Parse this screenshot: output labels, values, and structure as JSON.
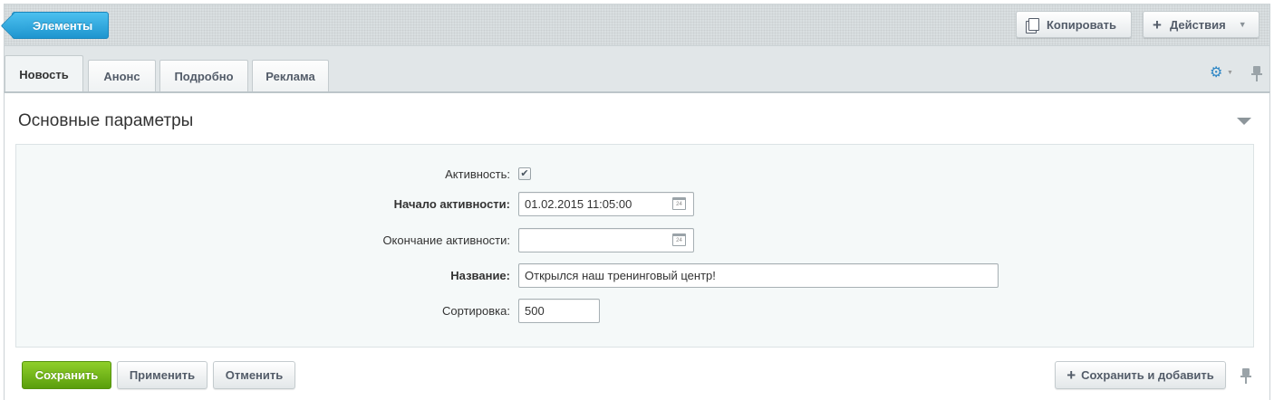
{
  "toolbar": {
    "back_label": "Элементы",
    "copy_label": "Копировать",
    "actions_label": "Действия",
    "icons": {
      "copy": "copy-icon",
      "plus": "plus-icon",
      "caret": "chevron-down-icon"
    }
  },
  "tabs": [
    {
      "label": "Новость",
      "active": true
    },
    {
      "label": "Анонс",
      "active": false
    },
    {
      "label": "Подробно",
      "active": false
    },
    {
      "label": "Реклама",
      "active": false
    }
  ],
  "section": {
    "title": "Основные параметры"
  },
  "form": {
    "active_label": "Активность:",
    "active_checked": true,
    "start_label": "Начало активности:",
    "start_value": "01.02.2015 11:05:00",
    "end_label": "Окончание активности:",
    "end_value": "",
    "name_label": "Название:",
    "name_value": "Открылся наш тренинговый центр!",
    "sort_label": "Сортировка:",
    "sort_value": "500"
  },
  "buttons": {
    "save": "Сохранить",
    "apply": "Применить",
    "cancel": "Отменить",
    "save_and_add": "Сохранить и добавить"
  },
  "colors": {
    "accent_blue": "#1e95cf",
    "save_green": "#6cb216",
    "toolbar_bg": "#d9dfe1",
    "panel_bg": "#f5f9f9"
  }
}
